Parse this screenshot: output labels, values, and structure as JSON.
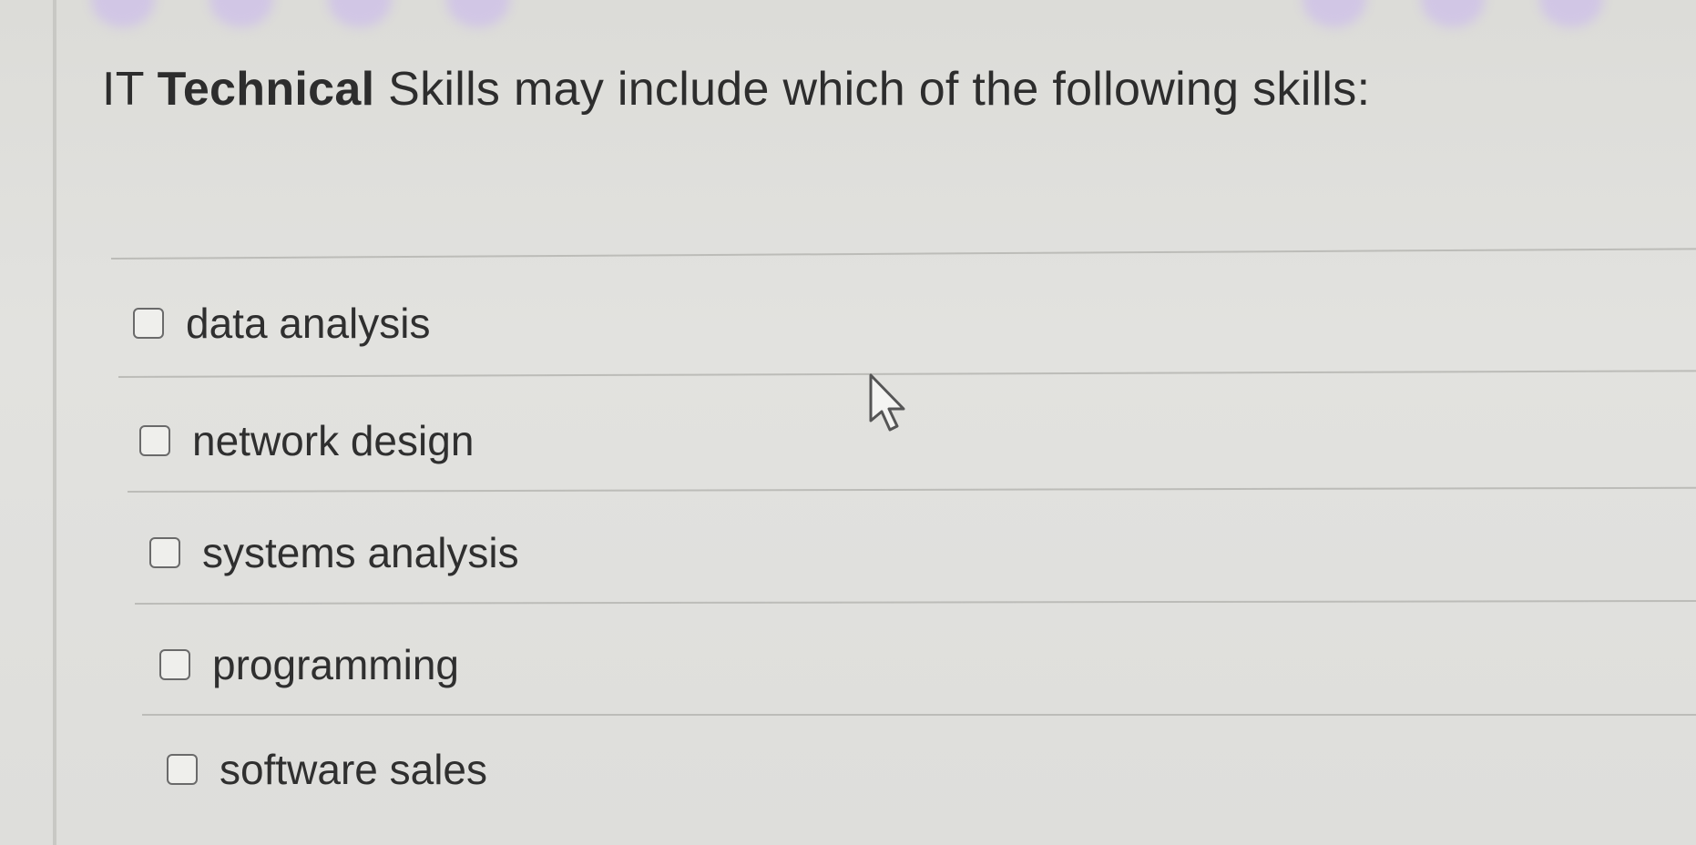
{
  "question": {
    "prefix": "IT ",
    "emphasis": "Technical",
    "suffix": " Skills may include which of the following skills:"
  },
  "options": [
    {
      "label": "data analysis",
      "checked": false
    },
    {
      "label": "network design",
      "checked": false
    },
    {
      "label": "systems analysis",
      "checked": false
    },
    {
      "label": "programming",
      "checked": false
    },
    {
      "label": "software sales",
      "checked": false
    }
  ],
  "cursor_icon": "arrow-pointer-icon"
}
